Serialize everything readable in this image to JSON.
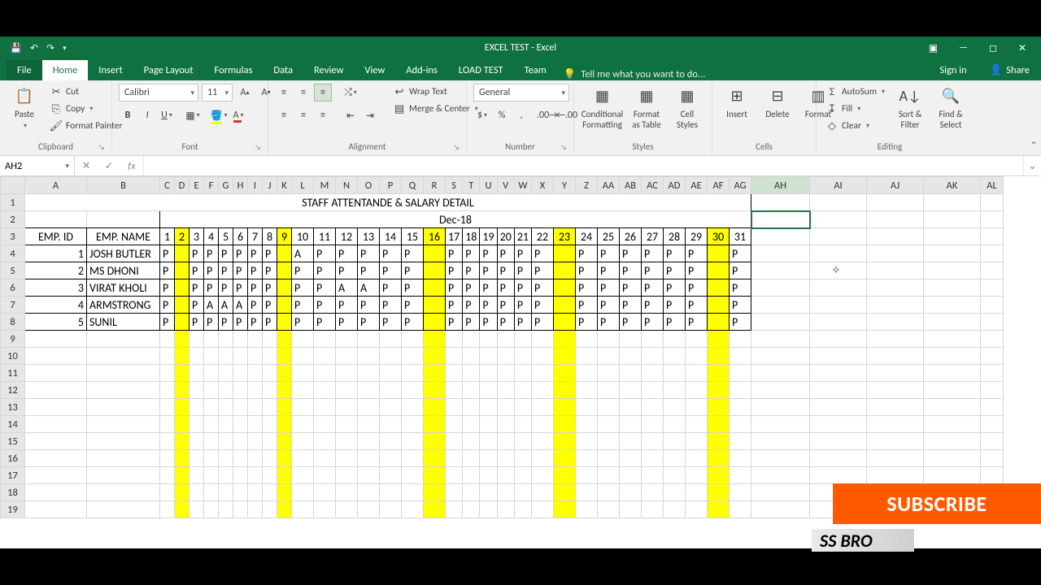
{
  "titlebar": {
    "title": "EXCEL TEST - Excel"
  },
  "tabs": {
    "file": "File",
    "home": "Home",
    "insert": "Insert",
    "page_layout": "Page Layout",
    "formulas": "Formulas",
    "data": "Data",
    "review": "Review",
    "view": "View",
    "addins": "Add-ins",
    "load_test": "LOAD TEST",
    "team": "Team",
    "tell_me": "Tell me what you want to do...",
    "signin": "Sign in",
    "share": "Share"
  },
  "ribbon": {
    "clipboard": {
      "label": "Clipboard",
      "paste": "Paste",
      "cut": "Cut",
      "copy": "Copy",
      "format_painter": "Format Painter"
    },
    "font": {
      "label": "Font",
      "name": "Calibri",
      "size": "11"
    },
    "alignment": {
      "label": "Alignment",
      "wrap": "Wrap Text",
      "merge": "Merge & Center"
    },
    "number": {
      "label": "Number",
      "format": "General"
    },
    "styles": {
      "label": "Styles",
      "cond": "Conditional Formatting",
      "table": "Format as Table",
      "cell": "Cell Styles"
    },
    "cells": {
      "label": "Cells",
      "insert": "Insert",
      "delete": "Delete",
      "format": "Format"
    },
    "editing": {
      "label": "Editing",
      "autosum": "AutoSum",
      "fill": "Fill",
      "clear": "Clear",
      "sort": "Sort & Filter",
      "find": "Find & Select"
    }
  },
  "fx": {
    "cell_ref": "AH2",
    "fx": "fx",
    "formula": ""
  },
  "columns": [
    "A",
    "B",
    "C",
    "D",
    "E",
    "F",
    "G",
    "H",
    "I",
    "J",
    "K",
    "L",
    "M",
    "N",
    "O",
    "P",
    "Q",
    "R",
    "S",
    "T",
    "U",
    "V",
    "W",
    "X",
    "Y",
    "Z",
    "AA",
    "AB",
    "AC",
    "AD",
    "AE",
    "AF",
    "AG",
    "AH",
    "AI",
    "AJ",
    "AK",
    "AL"
  ],
  "col_widths": {
    "A": 76,
    "B": 90,
    "default_day": 18,
    "wide_day": 27,
    "AH": 72,
    "tail": 70,
    "AL": 28
  },
  "wide_day_cols": [
    "L",
    "M",
    "N",
    "O",
    "P",
    "Q",
    "R",
    "X",
    "Y",
    "Z",
    "AA",
    "AB",
    "AC",
    "AD",
    "AE",
    "AF",
    "AG"
  ],
  "sheet": {
    "title": "STAFF ATTENTANDE & SALARY DETAIL",
    "period": "Dec-18",
    "hdr_id": "EMP. ID",
    "hdr_name": "EMP. NAME",
    "days": [
      "1",
      "2",
      "3",
      "4",
      "5",
      "6",
      "7",
      "8",
      "9",
      "10",
      "11",
      "12",
      "13",
      "14",
      "15",
      "16",
      "17",
      "18",
      "19",
      "20",
      "21",
      "22",
      "23",
      "24",
      "25",
      "26",
      "27",
      "28",
      "29",
      "30",
      "31"
    ],
    "yellow_days": [
      "2",
      "9",
      "16",
      "23",
      "30"
    ],
    "rows": [
      {
        "id": "1",
        "name": "JOSH BUTLER",
        "att": [
          "P",
          "",
          "P",
          "P",
          "P",
          "P",
          "P",
          "P",
          "",
          "A",
          "P",
          "P",
          "P",
          "P",
          "P",
          "",
          "P",
          "P",
          "P",
          "P",
          "P",
          "P",
          "",
          "P",
          "P",
          "P",
          "P",
          "P",
          "P",
          "",
          "P"
        ]
      },
      {
        "id": "2",
        "name": "MS DHONI",
        "att": [
          "P",
          "",
          "P",
          "P",
          "P",
          "P",
          "P",
          "P",
          "",
          "P",
          "P",
          "P",
          "P",
          "P",
          "P",
          "",
          "P",
          "P",
          "P",
          "P",
          "P",
          "P",
          "",
          "P",
          "P",
          "P",
          "P",
          "P",
          "P",
          "",
          "P"
        ]
      },
      {
        "id": "3",
        "name": "VIRAT KHOLI",
        "att": [
          "P",
          "",
          "P",
          "P",
          "P",
          "P",
          "P",
          "P",
          "",
          "P",
          "P",
          "A",
          "A",
          "P",
          "P",
          "",
          "P",
          "P",
          "P",
          "P",
          "P",
          "P",
          "",
          "P",
          "P",
          "P",
          "P",
          "P",
          "P",
          "",
          "P"
        ]
      },
      {
        "id": "4",
        "name": "ARMSTRONG",
        "att": [
          "P",
          "",
          "P",
          "A",
          "A",
          "A",
          "P",
          "P",
          "",
          "P",
          "P",
          "P",
          "P",
          "P",
          "P",
          "",
          "P",
          "P",
          "P",
          "P",
          "P",
          "P",
          "",
          "P",
          "P",
          "P",
          "P",
          "P",
          "P",
          "",
          "P"
        ]
      },
      {
        "id": "5",
        "name": "SUNIL",
        "att": [
          "P",
          "",
          "P",
          "P",
          "P",
          "P",
          "P",
          "P",
          "",
          "P",
          "P",
          "P",
          "P",
          "P",
          "P",
          "",
          "P",
          "P",
          "P",
          "P",
          "P",
          "P",
          "",
          "P",
          "P",
          "P",
          "P",
          "P",
          "P",
          "",
          "P"
        ]
      }
    ]
  },
  "row_headers": [
    "1",
    "2",
    "3",
    "4",
    "5",
    "6",
    "7",
    "8",
    "9",
    "10",
    "11",
    "12",
    "13",
    "14",
    "15",
    "16",
    "17",
    "18",
    "19"
  ],
  "overlay": {
    "subscribe": "SUBSCRIBE",
    "ssbro": "SS BRO"
  }
}
